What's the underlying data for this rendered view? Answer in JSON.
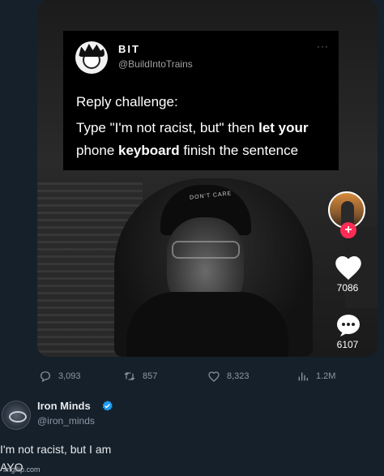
{
  "embedded_tweet": {
    "name": "BIT",
    "handle": "@BuildIntoTrains",
    "more": "···",
    "line1": "Reply challenge:",
    "line2_prefix": "Type \"I'm not racist, but\" then ",
    "line2_bold": "let your",
    "line3_prefix": "phone ",
    "line3_bold": "keyboard",
    "line3_suffix": " finish the sentence"
  },
  "video": {
    "cap_text": "DON'T CARE",
    "like_count": "7086",
    "comment_count": "6107",
    "follow_symbol": "+"
  },
  "actions": {
    "replies": "3,093",
    "retweets": "857",
    "likes": "8,323",
    "views": "1.2M"
  },
  "reply": {
    "name": "Iron Minds",
    "handle": "@iron_minds",
    "text_line1": "I'm not racist, but I am",
    "text_line2": "AYO"
  },
  "watermark": "imgflip.com",
  "colors": {
    "background": "#15202b",
    "verified": "#1d9bf0",
    "tiktok_red": "#fe2c55",
    "muted": "#8b98a5"
  }
}
